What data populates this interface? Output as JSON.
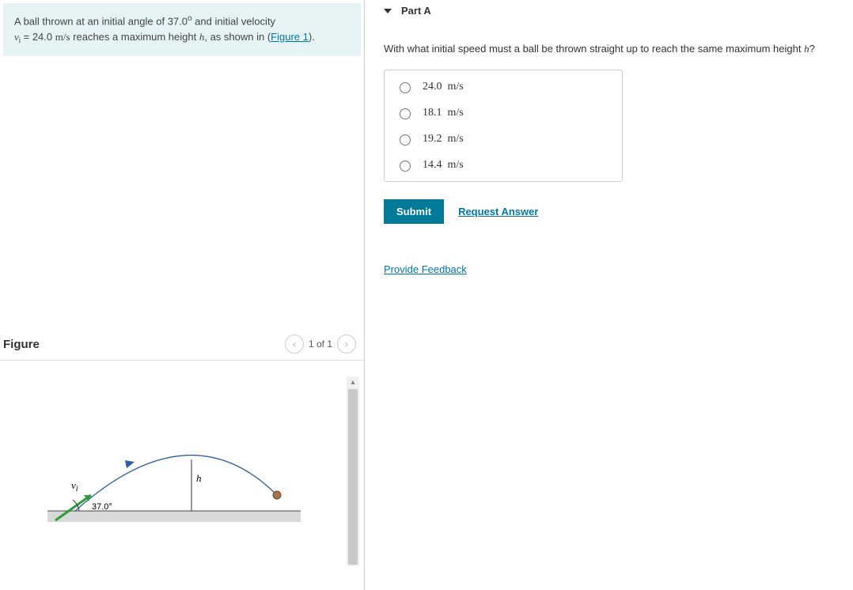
{
  "problem": {
    "line1_pre": "A ball thrown at an initial angle of ",
    "angle": "37.0",
    "line1_post": " and initial velocity",
    "vi_sym": "v",
    "vi_sub": "i",
    "vi_eq": " = 24.0 ",
    "vi_units": "m/s",
    "line2_mid": " reaches a maximum height ",
    "h_sym": "h",
    "line2_post": ", as shown in (",
    "figure_link": "Figure 1",
    "line2_end": ")."
  },
  "figure": {
    "title": "Figure",
    "pager": "1 of 1",
    "vi_label": "v",
    "vi_sub": "i",
    "angle_label": "37.0°",
    "h_label": "h"
  },
  "part": {
    "label": "Part A",
    "question_pre": "With what initial speed must a ball be thrown straight up to reach the same maximum height ",
    "question_var": "h",
    "question_post": "?",
    "options": [
      {
        "value": "24.0",
        "units": "m/s"
      },
      {
        "value": "18.1",
        "units": "m/s"
      },
      {
        "value": "19.2",
        "units": "m/s"
      },
      {
        "value": "14.4",
        "units": "m/s"
      }
    ],
    "submit": "Submit",
    "request_answer": "Request Answer"
  },
  "feedback_link": "Provide Feedback"
}
